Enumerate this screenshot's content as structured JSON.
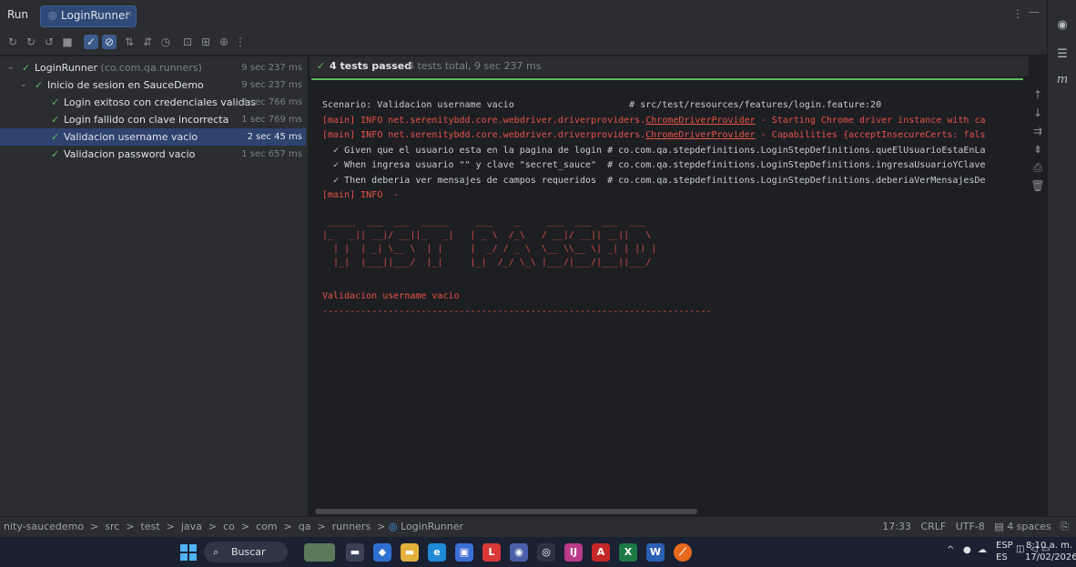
{
  "window": {
    "run_label": "Run",
    "tab_label": "LoginRunner",
    "tab_close": "×",
    "more": "⋮",
    "minimize": "—"
  },
  "tree": {
    "root": {
      "name": "LoginRunner",
      "package": "(co.com.qa.runners)",
      "time": "9 sec 237 ms"
    },
    "feature": {
      "name": "Inicio de sesion en SauceDemo",
      "time": "9 sec 237 ms"
    },
    "tests": [
      {
        "name": "Login exitoso con credenciales validas",
        "time": "3 sec 766 ms"
      },
      {
        "name": "Login fallido con clave incorrecta",
        "time": "1 sec 769 ms"
      },
      {
        "name": "Validacion username vacio",
        "time": "2 sec 45 ms"
      },
      {
        "name": "Validacion password vacio",
        "time": "1 sec 657 ms"
      }
    ]
  },
  "status": {
    "title": "4 tests passed",
    "details": "4 tests total, 9 sec 237 ms"
  },
  "console": {
    "scenario_line": "Scenario: Validacion username vacio                     # src/test/resources/features/login.feature:20",
    "info1_prefix": "[main] INFO net.serenitybdd.core.webdriver.driverproviders.",
    "info1_link": "ChromeDriverProvider",
    "info1_suffix": " - Starting Chrome driver instance with ca",
    "info2_prefix": "[main] INFO net.serenitybdd.core.webdriver.driverproviders.",
    "info2_link": "ChromeDriverProvider",
    "info2_suffix": " - Capabilities {acceptInsecureCerts: fals",
    "step1": "  ✓ Given que el usuario esta en la pagina de login # co.com.qa.stepdefinitions.LoginStepDefinitions.queElUsuarioEstaEnLa",
    "step2": "  ✓ When ingresa usuario \"\" y clave \"secret_sauce\"  # co.com.qa.stepdefinitions.LoginStepDefinitions.ingresaUsuarioYClave",
    "step3": "  ✓ Then deberia ver mensajes de campos requeridos  # co.com.qa.stepdefinitions.LoginStepDefinitions.deberiaVerMensajesDe",
    "info3": "[main] INFO  -",
    "banner": " _____  ___  ___  _____     ___    _     ___  ___  ___  ___\n|_   _|| __|/ __||_   _|   | _ \\  /_\\   / __|/ __|| __||   \\\n  | |  | _| \\__ \\  | |     |  _/ / _ \\  \\__ \\\\__ \\| _| | |) |\n  |_|  |___||___/  |_|     |_|  /_/ \\_\\ |___/|___/|___||___/",
    "scenario_title": "Validacion username vacio",
    "dashes": "-----------------------------------------------------------------------"
  },
  "statusbar": {
    "breadcrumb": "nity-saucedemo  >  src  >  test  >  java  >  co  >  com  >  qa  >  runners  >",
    "runner": "LoginRunner",
    "position": "17:33",
    "line_sep": "CRLF",
    "encoding": "UTF-8",
    "indent": "4 spaces"
  },
  "taskbar": {
    "search_label": "Buscar",
    "lang_top": "ESP",
    "lang_bottom": "ES",
    "time": "8:10 a. m.",
    "date": "17/02/2026"
  }
}
